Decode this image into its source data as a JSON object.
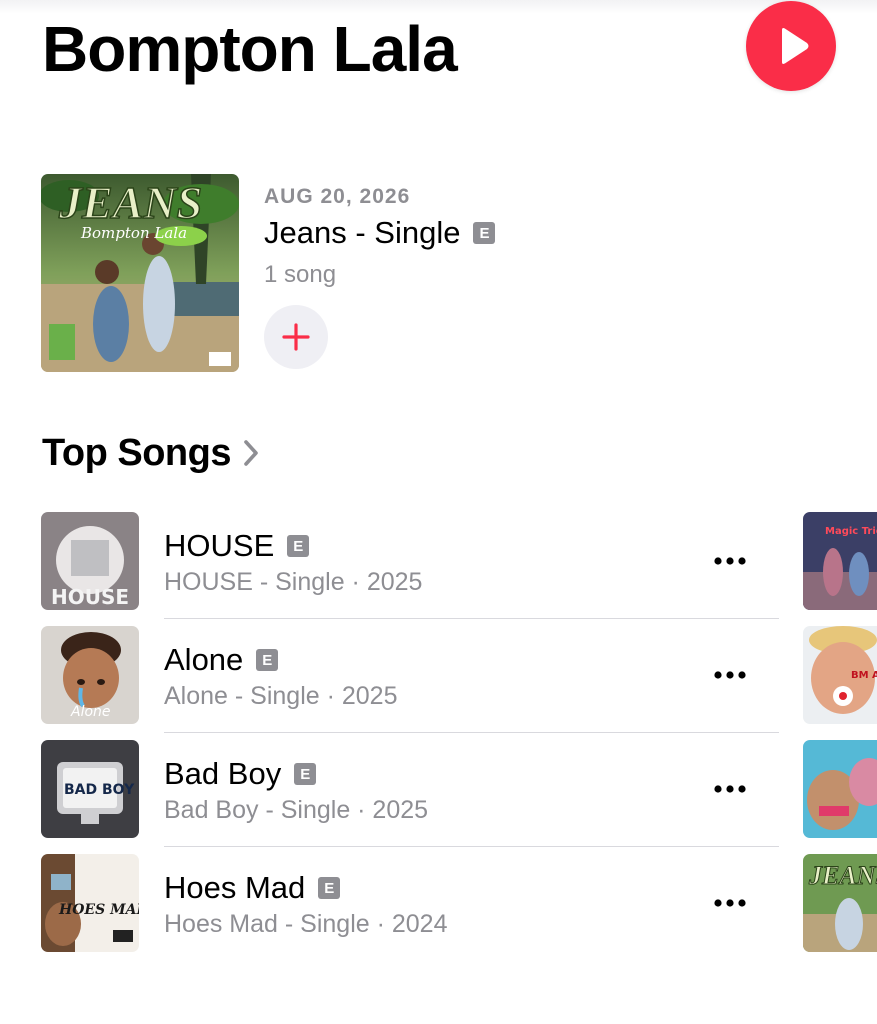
{
  "artist": {
    "name": "Bompton Lala"
  },
  "latest_release": {
    "date": "AUG 20, 2026",
    "title": "Jeans - Single",
    "explicit_badge": "E",
    "count": "1 song",
    "cover_text": {
      "title": "JEANS",
      "artist": "Bompton Lala"
    }
  },
  "top_songs": {
    "heading": "Top Songs",
    "items": [
      {
        "title": "HOUSE",
        "explicit_badge": "E",
        "subtitle": "HOUSE - Single · 2025",
        "cover_text": "HOUSE"
      },
      {
        "title": "Alone",
        "explicit_badge": "E",
        "subtitle": "Alone - Single · 2025",
        "cover_text": "Alone"
      },
      {
        "title": "Bad Boy",
        "explicit_badge": "E",
        "subtitle": "Bad Boy - Single · 2025",
        "cover_text": "BAD BOY"
      },
      {
        "title": "Hoes Mad",
        "explicit_badge": "E",
        "subtitle": "Hoes Mad - Single · 2024",
        "cover_text": "HOES MAD"
      }
    ],
    "next_column_cover_text": [
      "Magic Trick",
      "BM ANT",
      "",
      "JEANS"
    ]
  },
  "colors": {
    "accent": "#fa2d48",
    "secondary_text": "#8e8e93",
    "separator": "#d9d9de"
  },
  "icons": {
    "play": "play-icon",
    "add": "plus-icon",
    "more": "ellipsis-icon",
    "chevron": "chevron-right-icon"
  }
}
